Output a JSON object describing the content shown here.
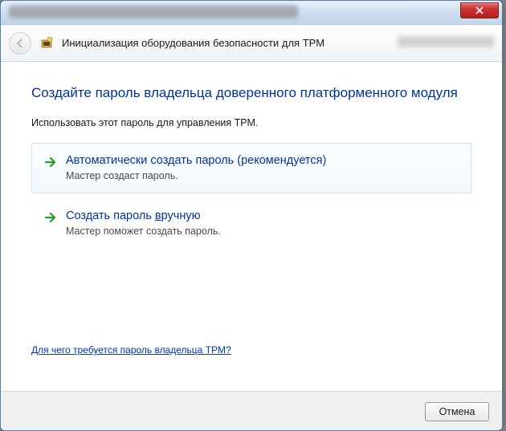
{
  "window": {
    "title": "Инициализация оборудования безопасности для TPM"
  },
  "page": {
    "heading": "Создайте пароль владельца доверенного платформенного модуля",
    "instruction": "Использовать этот пароль для управления TPM."
  },
  "options": {
    "auto": {
      "title": "Автоматически создать пароль (рекомендуется)",
      "desc": "Мастер создаст пароль."
    },
    "manual": {
      "title_prefix": "Создать пароль ",
      "title_underlined": "в",
      "title_suffix": "ручную",
      "desc": "Мастер поможет создать пароль."
    }
  },
  "help_link": "Для чего требуется пароль владельца TPM?",
  "footer": {
    "cancel": "Отмена"
  }
}
